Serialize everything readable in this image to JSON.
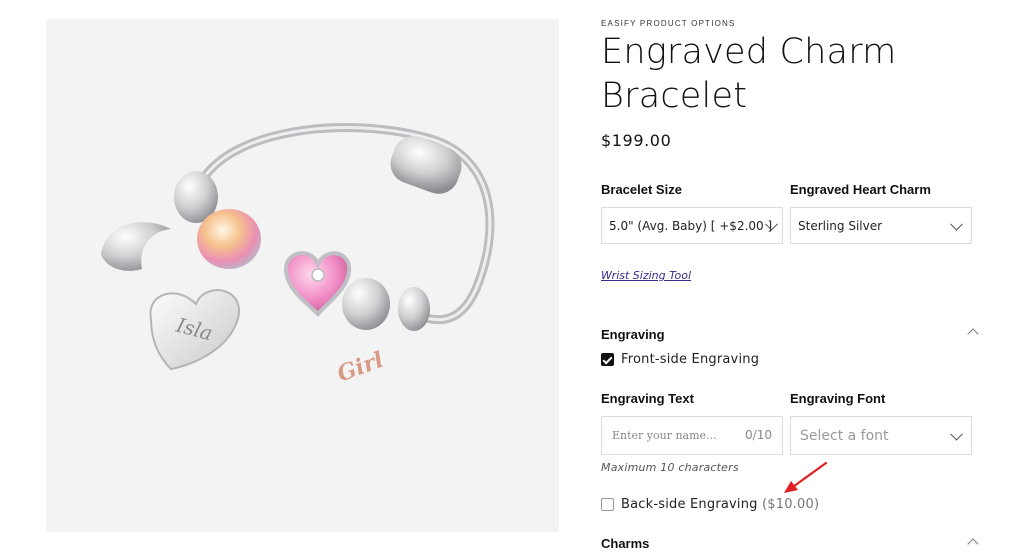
{
  "product": {
    "vendor": "EASIFY PRODUCT OPTIONS",
    "title": "Engraved Charm Bracelet",
    "price": "$199.00",
    "image_alt": "Silver charm bracelet with heart engraved Isla"
  },
  "image_engravings": {
    "heart": "Isla",
    "charm": "Girl"
  },
  "options": {
    "bracelet_size": {
      "label": "Bracelet Size",
      "value": "5.0\" (Avg. Baby) [ +$2.00 ]"
    },
    "heart_charm": {
      "label": "Engraved Heart Charm",
      "value": "Sterling Silver"
    },
    "sizing_link": "Wrist Sizing Tool"
  },
  "engraving": {
    "title": "Engraving",
    "front_checkbox": {
      "label": "Front-side Engraving",
      "checked": true
    },
    "text_field": {
      "label": "Engraving Text",
      "placeholder": "Enter your name...",
      "value": "",
      "counter": "0/10"
    },
    "font_field": {
      "label": "Engraving Font",
      "placeholder": "Select a font"
    },
    "helper": "Maximum 10 characters",
    "back_checkbox": {
      "label": "Back-side Engraving",
      "price": "($10.00)",
      "checked": false
    }
  },
  "charms": {
    "title": "Charms"
  },
  "colors": {
    "annotation_arrow": "#e02020",
    "link": "#3b2a8c",
    "image_bg": "#f3f3f3"
  }
}
